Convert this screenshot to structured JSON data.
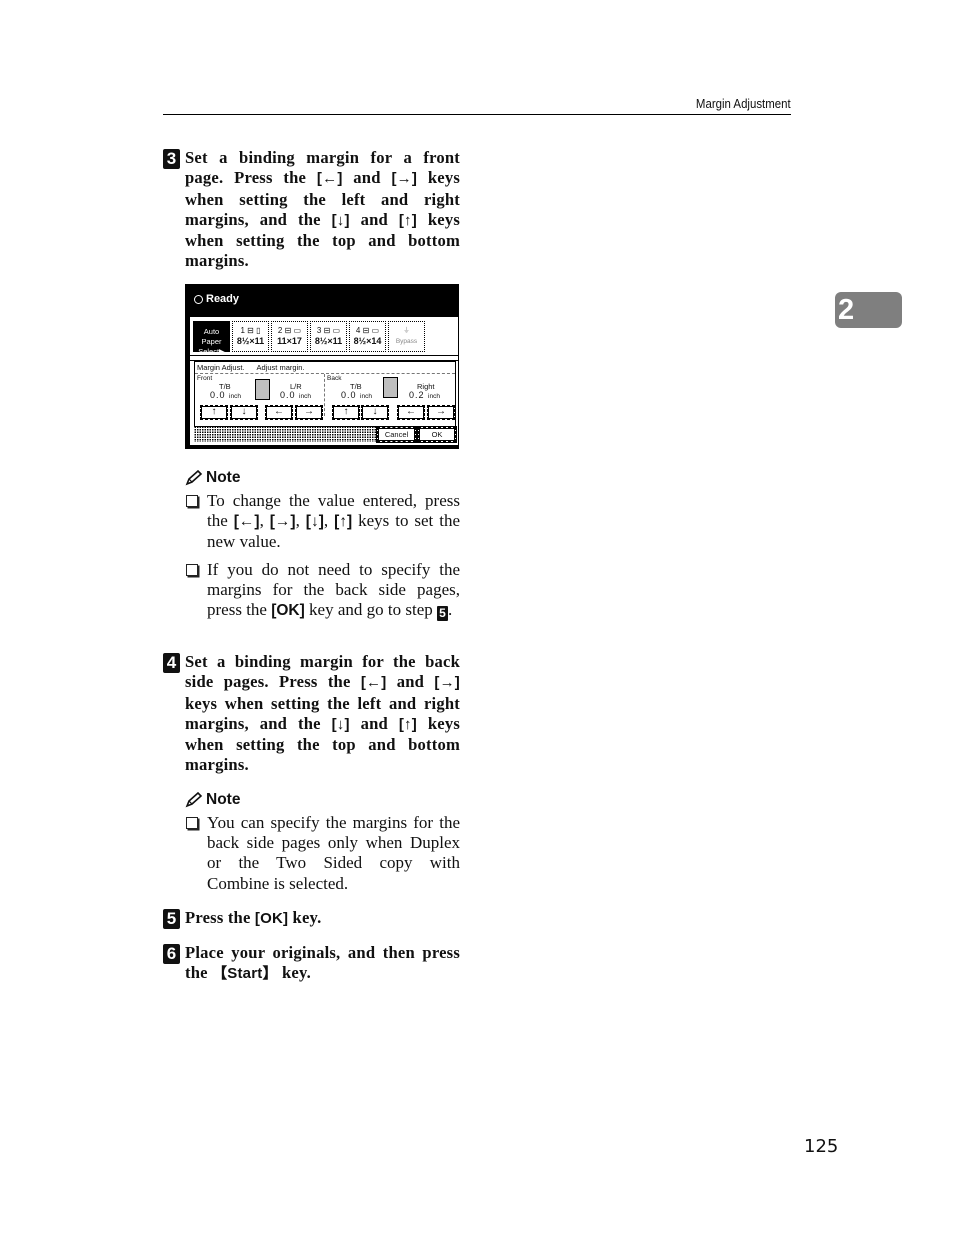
{
  "header": {
    "section_title": "Margin Adjustment"
  },
  "chapter_tab": "2",
  "page_number": "125",
  "steps": [
    {
      "number": "3",
      "parts": [
        "Set a binding margin for a front page. Press the ",
        "[←]",
        " and ",
        "[→]",
        " keys when setting the left and right margins, and the ",
        "[↓]",
        " and ",
        "[↑]",
        " keys when setting the top and bottom margins."
      ]
    },
    {
      "number": "4",
      "parts": [
        "Set a binding margin for the back side pages. Press the ",
        "[←]",
        " and ",
        "[→]",
        " keys when setting the left and right margins, and the ",
        "[↓]",
        " and ",
        "[↑]",
        " keys when setting the top and bottom margins."
      ]
    },
    {
      "number": "5",
      "parts": [
        "Press the ",
        "[OK]",
        " key."
      ]
    },
    {
      "number": "6",
      "parts": [
        "Place your originals, and then press the ",
        "【Start】",
        " key."
      ]
    }
  ],
  "notes": [
    {
      "title": "Note",
      "items": [
        {
          "parts": [
            "To change the value entered, press the ",
            "[←]",
            ", ",
            "[→]",
            ", ",
            "[↓]",
            ", ",
            "[↑]",
            " keys to set the new value."
          ]
        },
        {
          "parts": [
            "If you do not need to specify the margins for the back side pages, press the ",
            "[OK]",
            " key and go to step "
          ],
          "step_ref": "5",
          "tail": "."
        }
      ]
    },
    {
      "title": "Note",
      "items": [
        {
          "parts": [
            "You can specify the margins for the back side pages only when Duplex or the Two Sided copy with Combine is selected."
          ]
        }
      ]
    }
  ],
  "screen": {
    "status": "Ready",
    "trays": [
      {
        "label": "Auto Paper",
        "label2": "Select▶",
        "selected": true
      },
      {
        "label": "1 ⊟ ▯",
        "size": "8½×11"
      },
      {
        "label": "2 ⊟ ▭",
        "size": "11×17"
      },
      {
        "label": "3 ⊟ ▭",
        "size": "8½×11"
      },
      {
        "label": "4 ⊟ ▭",
        "size": "8½×14"
      },
      {
        "label": "⏚",
        "size": "Bypass",
        "disabled": true
      }
    ],
    "panel_title": "Margin Adjust.",
    "panel_subtitle": "Adjust margin.",
    "front": {
      "label": "Front",
      "tb_label": "T/B",
      "tb_value": "0.0",
      "lr_label": "L/R",
      "lr_value": "0.0",
      "unit": "inch"
    },
    "back": {
      "label": "Back",
      "tb_label": "T/B",
      "tb_value": "0.0",
      "lr_label": "Right",
      "lr_value": "0.2",
      "unit": "inch"
    },
    "arrows": {
      "up": "↑",
      "down": "↓",
      "left": "←",
      "right": "→"
    },
    "cancel": "Cancel",
    "ok": "OK"
  }
}
